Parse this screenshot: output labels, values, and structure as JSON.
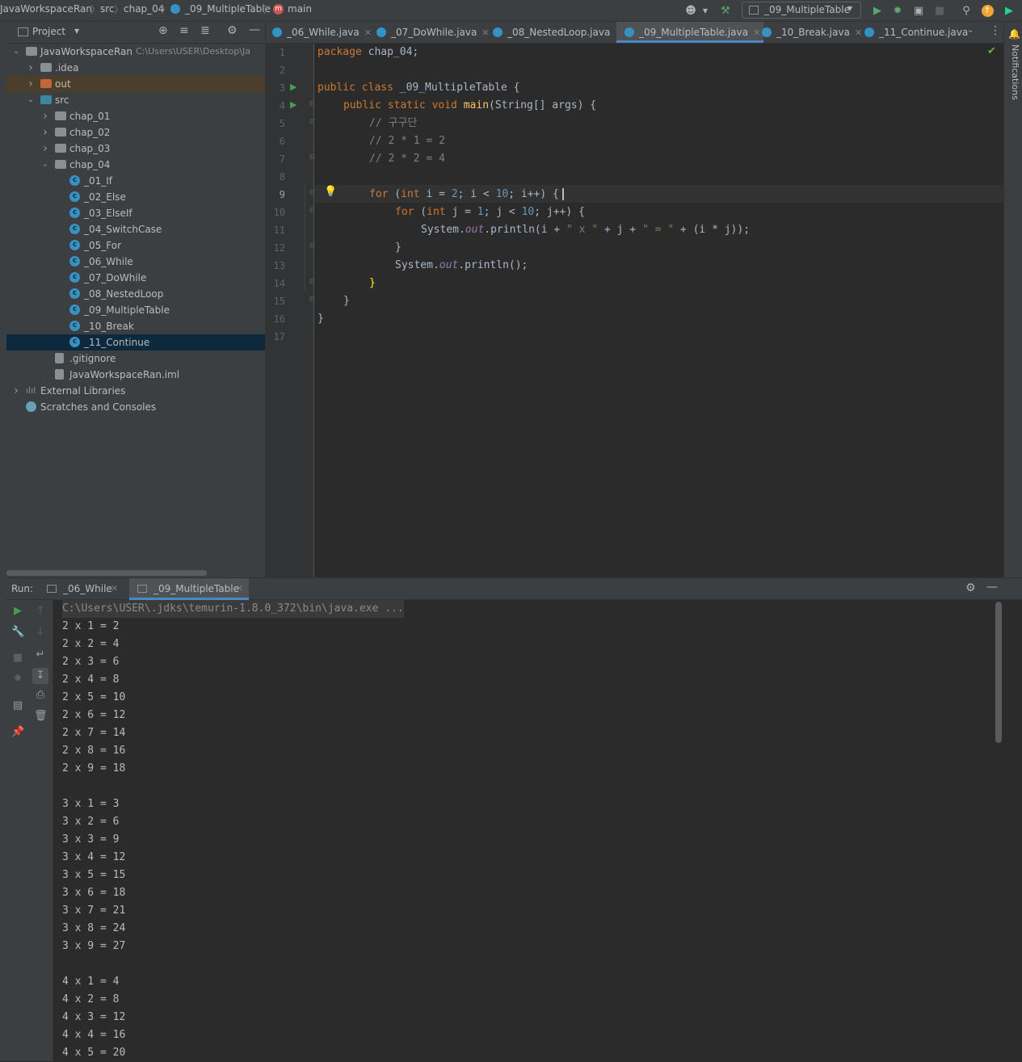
{
  "navbar": {
    "breadcrumbs": [
      "JavaWorkspaceRan",
      "src",
      "chap_04",
      "_09_MultipleTable",
      "main"
    ],
    "run_config": "_09_MultipleTable"
  },
  "project_panel": {
    "title": "Project",
    "tree": [
      {
        "label": "JavaWorkspaceRan",
        "extra": "C:\\Users\\USER\\Desktop\\Ja",
        "indent": 0,
        "arrow": "v",
        "icon": "folder-gray"
      },
      {
        "label": ".idea",
        "indent": 1,
        "arrow": ">",
        "icon": "folder-gray"
      },
      {
        "label": "out",
        "indent": 1,
        "arrow": ">",
        "icon": "folder-orange",
        "highlight": true
      },
      {
        "label": "src",
        "indent": 1,
        "arrow": "v",
        "icon": "folder-blue"
      },
      {
        "label": "chap_01",
        "indent": 2,
        "arrow": ">",
        "icon": "folder-gray"
      },
      {
        "label": "chap_02",
        "indent": 2,
        "arrow": ">",
        "icon": "folder-gray"
      },
      {
        "label": "chap_03",
        "indent": 2,
        "arrow": ">",
        "icon": "folder-gray"
      },
      {
        "label": "chap_04",
        "indent": 2,
        "arrow": "v",
        "icon": "folder-gray"
      },
      {
        "label": "_01_If",
        "indent": 3,
        "icon": "java"
      },
      {
        "label": "_02_Else",
        "indent": 3,
        "icon": "java"
      },
      {
        "label": "_03_ElseIf",
        "indent": 3,
        "icon": "java"
      },
      {
        "label": "_04_SwitchCase",
        "indent": 3,
        "icon": "java"
      },
      {
        "label": "_05_For",
        "indent": 3,
        "icon": "java"
      },
      {
        "label": "_06_While",
        "indent": 3,
        "icon": "java"
      },
      {
        "label": "_07_DoWhile",
        "indent": 3,
        "icon": "java"
      },
      {
        "label": "_08_NestedLoop",
        "indent": 3,
        "icon": "java"
      },
      {
        "label": "_09_MultipleTable",
        "indent": 3,
        "icon": "java"
      },
      {
        "label": "_10_Break",
        "indent": 3,
        "icon": "java"
      },
      {
        "label": "_11_Continue",
        "indent": 3,
        "icon": "java",
        "selected": true
      },
      {
        "label": ".gitignore",
        "indent": 2,
        "icon": "file"
      },
      {
        "label": "JavaWorkspaceRan.iml",
        "indent": 2,
        "icon": "file"
      },
      {
        "label": "External Libraries",
        "indent": 0,
        "arrow": ">",
        "icon": "library"
      },
      {
        "label": "Scratches and Consoles",
        "indent": 0,
        "icon": "scratch"
      }
    ]
  },
  "tabs": [
    {
      "label": "_06_While.java",
      "active": false
    },
    {
      "label": "_07_DoWhile.java",
      "active": false
    },
    {
      "label": "_08_NestedLoop.java",
      "active": false
    },
    {
      "label": "_09_MultipleTable.java",
      "active": true
    },
    {
      "label": "_10_Break.java",
      "active": false
    },
    {
      "label": "_11_Continue.java",
      "active": false
    }
  ],
  "editor": {
    "line_numbers": [
      "1",
      "2",
      "3",
      "4",
      "5",
      "6",
      "7",
      "8",
      "9",
      "10",
      "11",
      "12",
      "13",
      "14",
      "15",
      "16",
      "17"
    ],
    "lines": {
      "l1_kw": "package",
      "l1_rest": " chap_04;",
      "l3_kw": "public class",
      "l3_rest": " _09_MultipleTable {",
      "l4_kw": "public static void",
      "l4_fn": " main",
      "l4_rest": "(String[] args) {",
      "l5": "// 구구단",
      "l6": "// 2 * 1 = 2",
      "l7": "// 2 * 2 = 4",
      "l9_kw": "for",
      "l9_a": " (",
      "l9_kw2": "int",
      "l9_b": " i = ",
      "l9_n1": "2",
      "l9_c": "; i < ",
      "l9_n2": "10",
      "l9_d": "; i++) {",
      "l10_kw": "for",
      "l10_a": " (",
      "l10_kw2": "int",
      "l10_b": " j = ",
      "l10_n1": "1",
      "l10_c": "; j < ",
      "l10_n2": "10",
      "l10_d": "; j++) {",
      "l11_a": "System.",
      "l11_fld": "out",
      "l11_b": ".println(i + ",
      "l11_s1": "\" x \"",
      "l11_c": " + j + ",
      "l11_s2": "\" = \"",
      "l11_d": " + (i * j));",
      "l12": "}",
      "l13_a": "System.",
      "l13_fld": "out",
      "l13_b": ".println();",
      "l14": "}",
      "l15": "}",
      "l16": "}"
    }
  },
  "run_panel": {
    "label": "Run:",
    "tabs": [
      "_06_While",
      "_09_MultipleTable"
    ],
    "command": "C:\\Users\\USER\\.jdks\\temurin-1.8.0_372\\bin\\java.exe ...",
    "output": [
      "2 x 1 = 2",
      "2 x 2 = 4",
      "2 x 3 = 6",
      "2 x 4 = 8",
      "2 x 5 = 10",
      "2 x 6 = 12",
      "2 x 7 = 14",
      "2 x 8 = 16",
      "2 x 9 = 18",
      "",
      "3 x 1 = 3",
      "3 x 2 = 6",
      "3 x 3 = 9",
      "3 x 4 = 12",
      "3 x 5 = 15",
      "3 x 6 = 18",
      "3 x 7 = 21",
      "3 x 8 = 24",
      "3 x 9 = 27",
      "",
      "4 x 1 = 4",
      "4 x 2 = 8",
      "4 x 3 = 12",
      "4 x 4 = 16",
      "4 x 5 = 20"
    ]
  },
  "right_stripe": {
    "notifications": "Notifications"
  }
}
